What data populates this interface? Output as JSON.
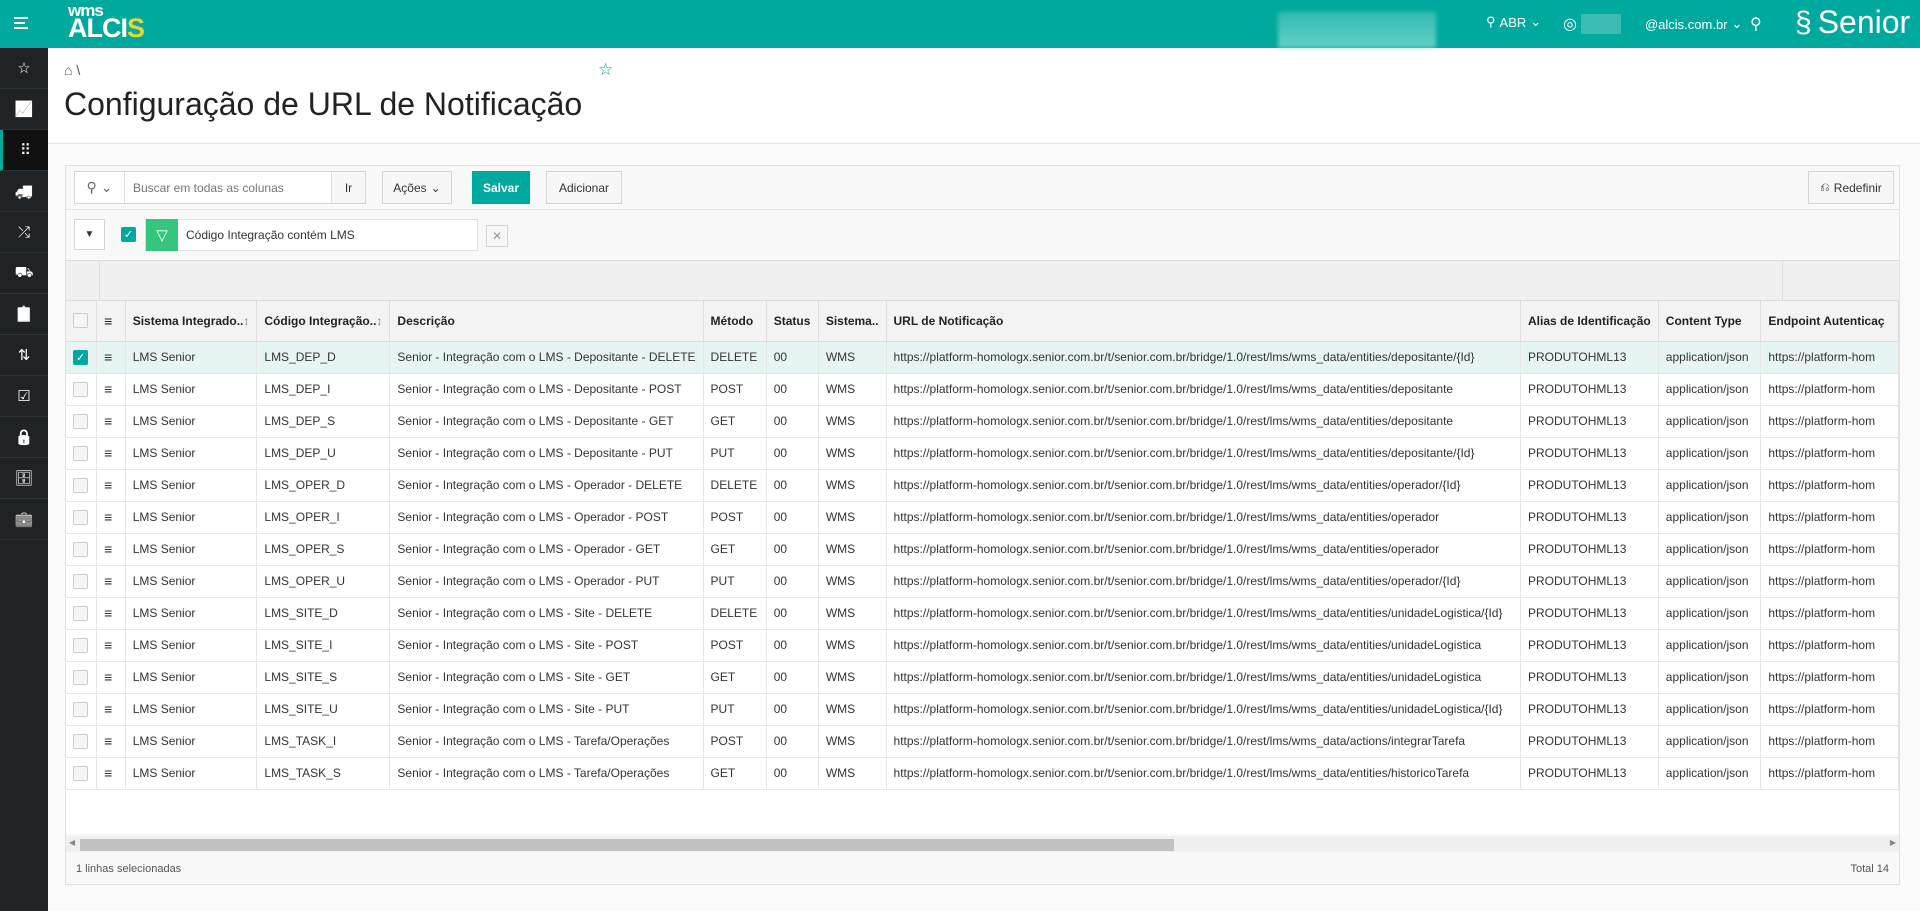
{
  "header": {
    "logo_top": "wms",
    "logo_main": "ALCIS",
    "location": "ABR",
    "user_email": "@alcis.com.br",
    "brand": "Senior"
  },
  "sidebar": {
    "items": [
      {
        "icon": "star-icon",
        "glyph": "☆"
      },
      {
        "icon": "chart-line-icon",
        "glyph": "📈"
      },
      {
        "icon": "apps-grid-icon",
        "glyph": "⠿"
      },
      {
        "icon": "truck-icon",
        "glyph": "🚚"
      },
      {
        "icon": "shuffle-icon",
        "glyph": "⤮"
      },
      {
        "icon": "delivery-truck-icon",
        "glyph": "⛟"
      },
      {
        "icon": "clipboard-check-icon",
        "glyph": "📋"
      },
      {
        "icon": "swap-arrows-icon",
        "glyph": "⇅"
      },
      {
        "icon": "checklist-icon",
        "glyph": "☑"
      },
      {
        "icon": "lock-icon",
        "glyph": "🔒"
      },
      {
        "icon": "archive-icon",
        "glyph": "🗄"
      },
      {
        "icon": "briefcase-icon",
        "glyph": "💼"
      }
    ]
  },
  "page": {
    "breadcrumb_sep": "\\",
    "title": "Configuração de URL de Notificação"
  },
  "toolbar": {
    "search_placeholder": "Buscar em todas as colunas",
    "go": "Ir",
    "actions": "Ações",
    "save": "Salvar",
    "add": "Adicionar",
    "reset": "Redefinir"
  },
  "filter": {
    "text": "Código Integração contém LMS"
  },
  "table": {
    "columns": [
      "Sistema Integrado..",
      "Código Integração..",
      "Descrição",
      "Método",
      "Status",
      "Sistema..",
      "URL de Notificação",
      "Alias de Identificação",
      "Content Type",
      "Endpoint Autenticaç"
    ],
    "rows": [
      [
        "LMS Senior",
        "LMS_DEP_D",
        "Senior - Integração com o LMS - Depositante - DELETE",
        "DELETE",
        "00",
        "WMS",
        "https://platform-homologx.senior.com.br/t/senior.com.br/bridge/1.0/rest/lms/wms_data/entities/depositante/{Id}",
        "PRODUTOHML13",
        "application/json",
        "https://platform-hom"
      ],
      [
        "LMS Senior",
        "LMS_DEP_I",
        "Senior - Integração com o LMS - Depositante - POST",
        "POST",
        "00",
        "WMS",
        "https://platform-homologx.senior.com.br/t/senior.com.br/bridge/1.0/rest/lms/wms_data/entities/depositante",
        "PRODUTOHML13",
        "application/json",
        "https://platform-hom"
      ],
      [
        "LMS Senior",
        "LMS_DEP_S",
        "Senior - Integração com o LMS - Depositante - GET",
        "GET",
        "00",
        "WMS",
        "https://platform-homologx.senior.com.br/t/senior.com.br/bridge/1.0/rest/lms/wms_data/entities/depositante",
        "PRODUTOHML13",
        "application/json",
        "https://platform-hom"
      ],
      [
        "LMS Senior",
        "LMS_DEP_U",
        "Senior - Integração com o LMS - Depositante - PUT",
        "PUT",
        "00",
        "WMS",
        "https://platform-homologx.senior.com.br/t/senior.com.br/bridge/1.0/rest/lms/wms_data/entities/depositante/{Id}",
        "PRODUTOHML13",
        "application/json",
        "https://platform-hom"
      ],
      [
        "LMS Senior",
        "LMS_OPER_D",
        "Senior - Integração com o LMS - Operador - DELETE",
        "DELETE",
        "00",
        "WMS",
        "https://platform-homologx.senior.com.br/t/senior.com.br/bridge/1.0/rest/lms/wms_data/entities/operador/{Id}",
        "PRODUTOHML13",
        "application/json",
        "https://platform-hom"
      ],
      [
        "LMS Senior",
        "LMS_OPER_I",
        "Senior - Integração com o LMS - Operador - POST",
        "POST",
        "00",
        "WMS",
        "https://platform-homologx.senior.com.br/t/senior.com.br/bridge/1.0/rest/lms/wms_data/entities/operador",
        "PRODUTOHML13",
        "application/json",
        "https://platform-hom"
      ],
      [
        "LMS Senior",
        "LMS_OPER_S",
        "Senior - Integração com o LMS - Operador - GET",
        "GET",
        "00",
        "WMS",
        "https://platform-homologx.senior.com.br/t/senior.com.br/bridge/1.0/rest/lms/wms_data/entities/operador",
        "PRODUTOHML13",
        "application/json",
        "https://platform-hom"
      ],
      [
        "LMS Senior",
        "LMS_OPER_U",
        "Senior - Integração com o LMS - Operador - PUT",
        "PUT",
        "00",
        "WMS",
        "https://platform-homologx.senior.com.br/t/senior.com.br/bridge/1.0/rest/lms/wms_data/entities/operador/{Id}",
        "PRODUTOHML13",
        "application/json",
        "https://platform-hom"
      ],
      [
        "LMS Senior",
        "LMS_SITE_D",
        "Senior - Integração com o LMS - Site - DELETE",
        "DELETE",
        "00",
        "WMS",
        "https://platform-homologx.senior.com.br/t/senior.com.br/bridge/1.0/rest/lms/wms_data/entities/unidadeLogistica/{Id}",
        "PRODUTOHML13",
        "application/json",
        "https://platform-hom"
      ],
      [
        "LMS Senior",
        "LMS_SITE_I",
        "Senior - Integração com o LMS - Site - POST",
        "POST",
        "00",
        "WMS",
        "https://platform-homologx.senior.com.br/t/senior.com.br/bridge/1.0/rest/lms/wms_data/entities/unidadeLogistica",
        "PRODUTOHML13",
        "application/json",
        "https://platform-hom"
      ],
      [
        "LMS Senior",
        "LMS_SITE_S",
        "Senior - Integração com o LMS - Site - GET",
        "GET",
        "00",
        "WMS",
        "https://platform-homologx.senior.com.br/t/senior.com.br/bridge/1.0/rest/lms/wms_data/entities/unidadeLogistica",
        "PRODUTOHML13",
        "application/json",
        "https://platform-hom"
      ],
      [
        "LMS Senior",
        "LMS_SITE_U",
        "Senior - Integração com o LMS - Site - PUT",
        "PUT",
        "00",
        "WMS",
        "https://platform-homologx.senior.com.br/t/senior.com.br/bridge/1.0/rest/lms/wms_data/entities/unidadeLogistica/{Id}",
        "PRODUTOHML13",
        "application/json",
        "https://platform-hom"
      ],
      [
        "LMS Senior",
        "LMS_TASK_I",
        "Senior - Integração com o LMS - Tarefa/Operações",
        "POST",
        "00",
        "WMS",
        "https://platform-homologx.senior.com.br/t/senior.com.br/bridge/1.0/rest/lms/wms_data/actions/integrarTarefa",
        "PRODUTOHML13",
        "application/json",
        "https://platform-hom"
      ],
      [
        "LMS Senior",
        "LMS_TASK_S",
        "Senior - Integração com o LMS - Tarefa/Operações",
        "GET",
        "00",
        "WMS",
        "https://platform-homologx.senior.com.br/t/senior.com.br/bridge/1.0/rest/lms/wms_data/entities/historicoTarefa",
        "PRODUTOHML13",
        "application/json",
        "https://platform-hom"
      ]
    ],
    "selected_rows": [
      0
    ]
  },
  "footer": {
    "selected": "1 linhas selecionadas",
    "total": "Total 14"
  },
  "colors": {
    "brand": "#00a99d",
    "sidebar": "#1f2325",
    "selected_row": "#e6f5f3"
  }
}
